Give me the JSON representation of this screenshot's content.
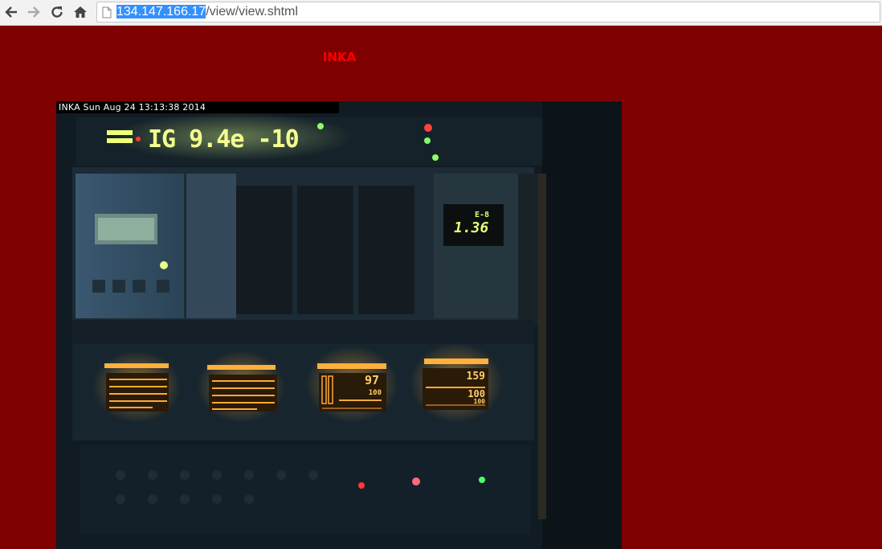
{
  "browser": {
    "url_host": "134.147.166.17",
    "url_path": "/view/view.shtml"
  },
  "page": {
    "title": "INKA"
  },
  "camera": {
    "overlay_text": "INKA  Sun Aug 24  13:13:38  2014",
    "gauge_main": "IG 9.4e -10",
    "gauge_small_exp": "E-8",
    "gauge_small_val": "1.36",
    "display3_val1": "97",
    "display3_val2": "100",
    "display4_val1": "159",
    "display4_val2": "100",
    "display4_val3": "100"
  },
  "colors": {
    "page_bg": "#7f0000",
    "title": "#ff0000",
    "selection": "#3390ff"
  }
}
